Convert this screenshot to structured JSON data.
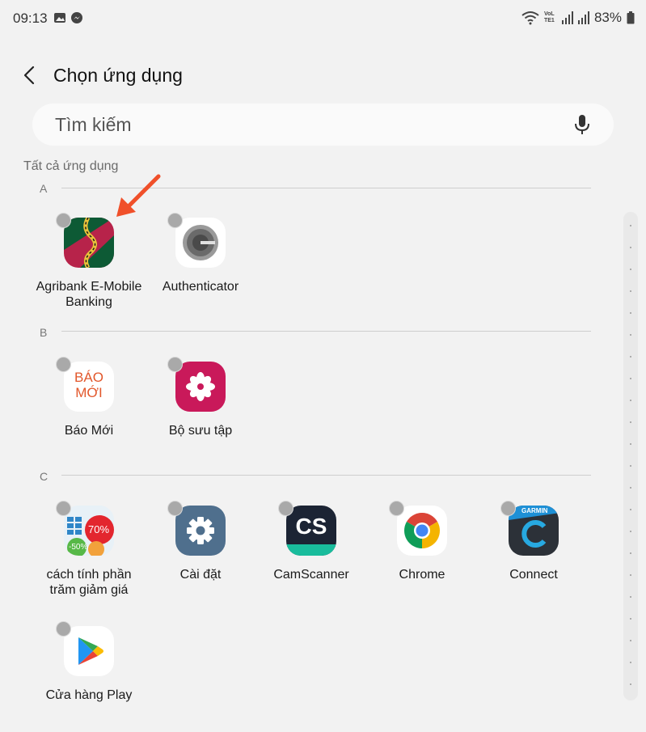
{
  "status_bar": {
    "time": "09:13",
    "battery": "83%",
    "network_badge": "VoLTE1"
  },
  "header": {
    "title": "Chọn ứng dụng"
  },
  "search": {
    "placeholder": "Tìm kiếm"
  },
  "section_label": "Tất cả ứng dụng",
  "groups": [
    {
      "letter": "A",
      "apps": [
        {
          "label": "Agribank E-Mobile Banking",
          "icon": "agribank-icon"
        },
        {
          "label": "Authenticator",
          "icon": "authenticator-icon"
        }
      ]
    },
    {
      "letter": "B",
      "apps": [
        {
          "label": "Báo Mới",
          "icon": "baomoi-icon",
          "icon_text": "BÁO MỚI"
        },
        {
          "label": "Bộ sưu tập",
          "icon": "gallery-icon"
        }
      ]
    },
    {
      "letter": "C",
      "apps": [
        {
          "label": "cách tính phần trăm giảm giá",
          "icon": "discount-calculator-icon",
          "icon_text_1": "70%",
          "icon_text_2": "-50%"
        },
        {
          "label": "Cài đặt",
          "icon": "settings-icon"
        },
        {
          "label": "CamScanner",
          "icon": "camscanner-icon",
          "icon_text": "CS"
        },
        {
          "label": "Chrome",
          "icon": "chrome-icon"
        },
        {
          "label": "Connect",
          "icon": "garmin-connect-icon",
          "icon_text": "GARMIN"
        },
        {
          "label": "Cửa hàng Play",
          "icon": "play-store-icon"
        }
      ]
    }
  ],
  "colors": {
    "background": "#f2f2f2",
    "arrow": "#f0502a",
    "radio": "#a9a9a9"
  }
}
